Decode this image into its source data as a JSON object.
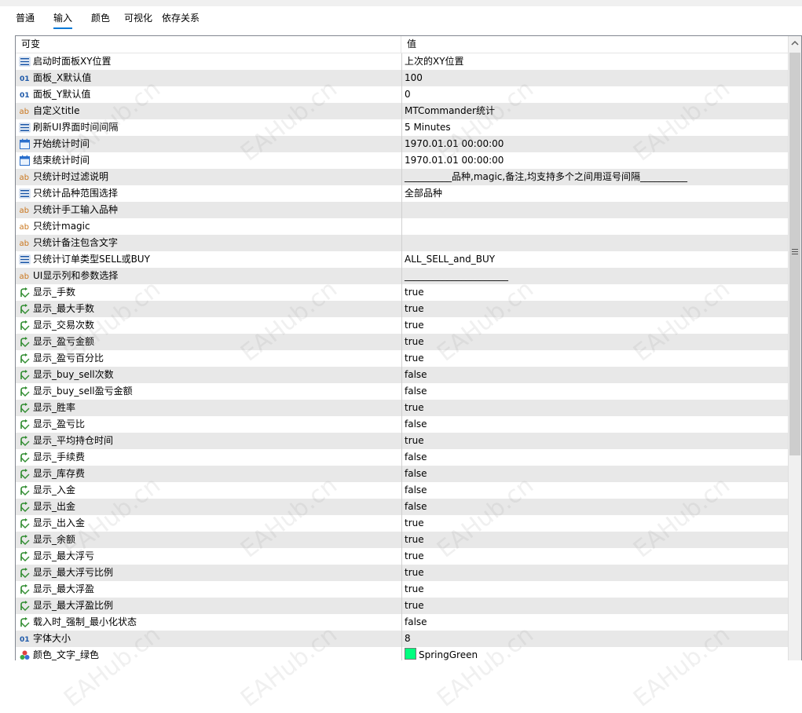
{
  "tabs": [
    {
      "label": "普通",
      "active": false
    },
    {
      "label": "输入",
      "active": true
    },
    {
      "label": "颜色",
      "active": false
    },
    {
      "label": "可视化",
      "active": false
    },
    {
      "label": "依存关系",
      "active": false
    }
  ],
  "header": {
    "variable": "可变",
    "value": "值"
  },
  "rows": [
    {
      "icon": "enum-icon",
      "name": "启动时面板XY位置",
      "value": "上次的XY位置"
    },
    {
      "icon": "int-icon",
      "name": "面板_X默认值",
      "value": "100"
    },
    {
      "icon": "int-icon",
      "name": "面板_Y默认值",
      "value": "0"
    },
    {
      "icon": "text-icon",
      "name": "自定义title",
      "value": "MTCommander统计"
    },
    {
      "icon": "enum-icon",
      "name": "刷新UI界面时间间隔",
      "value": "5 Minutes"
    },
    {
      "icon": "calendar-icon",
      "name": "开始统计时间",
      "value": "1970.01.01 00:00:00"
    },
    {
      "icon": "calendar-icon",
      "name": "结束统计时间",
      "value": "1970.01.01 00:00:00"
    },
    {
      "icon": "text-icon",
      "name": "只统计时过滤说明",
      "value": "__________品种,magic,备注,均支持多个之间用逗号间隔__________"
    },
    {
      "icon": "enum-icon",
      "name": "只统计品种范围选择",
      "value": "全部品种"
    },
    {
      "icon": "text-icon",
      "name": "只统计手工输入品种",
      "value": ""
    },
    {
      "icon": "text-icon",
      "name": "只统计magic",
      "value": ""
    },
    {
      "icon": "text-icon",
      "name": "只统计备注包含文字",
      "value": ""
    },
    {
      "icon": "enum-icon",
      "name": "只统计订单类型SELL或BUY",
      "value": "ALL_SELL_and_BUY"
    },
    {
      "icon": "text-icon",
      "name": "UI显示列和参数选择",
      "value": "______________________"
    },
    {
      "icon": "bool-icon",
      "name": "显示_手数",
      "value": "true"
    },
    {
      "icon": "bool-icon",
      "name": "显示_最大手数",
      "value": "true"
    },
    {
      "icon": "bool-icon",
      "name": "显示_交易次数",
      "value": "true"
    },
    {
      "icon": "bool-icon",
      "name": "显示_盈亏金额",
      "value": "true"
    },
    {
      "icon": "bool-icon",
      "name": "显示_盈亏百分比",
      "value": "true"
    },
    {
      "icon": "bool-icon",
      "name": "显示_buy_sell次数",
      "value": "false"
    },
    {
      "icon": "bool-icon",
      "name": "显示_buy_sell盈亏金额",
      "value": "false"
    },
    {
      "icon": "bool-icon",
      "name": "显示_胜率",
      "value": "true"
    },
    {
      "icon": "bool-icon",
      "name": "显示_盈亏比",
      "value": "false"
    },
    {
      "icon": "bool-icon",
      "name": "显示_平均持仓时间",
      "value": "true"
    },
    {
      "icon": "bool-icon",
      "name": "显示_手续费",
      "value": "false"
    },
    {
      "icon": "bool-icon",
      "name": "显示_库存费",
      "value": "false"
    },
    {
      "icon": "bool-icon",
      "name": "显示_入金",
      "value": "false"
    },
    {
      "icon": "bool-icon",
      "name": "显示_出金",
      "value": "false"
    },
    {
      "icon": "bool-icon",
      "name": "显示_出入金",
      "value": "true"
    },
    {
      "icon": "bool-icon",
      "name": "显示_余额",
      "value": "true"
    },
    {
      "icon": "bool-icon",
      "name": "显示_最大浮亏",
      "value": "true"
    },
    {
      "icon": "bool-icon",
      "name": "显示_最大浮亏比例",
      "value": "true"
    },
    {
      "icon": "bool-icon",
      "name": "显示_最大浮盈",
      "value": "true"
    },
    {
      "icon": "bool-icon",
      "name": "显示_最大浮盈比例",
      "value": "true"
    },
    {
      "icon": "bool-icon",
      "name": "载入时_强制_最小化状态",
      "value": "false"
    },
    {
      "icon": "int-icon",
      "name": "字体大小",
      "value": "8"
    },
    {
      "icon": "color-icon",
      "name": "颜色_文字_绿色",
      "value": "SpringGreen",
      "swatch": "#00ff7f"
    }
  ],
  "watermark": "EAHub.cn",
  "colors": {
    "accent": "#0078d7",
    "row_alt": "#e8e8e8",
    "text_icon": "#c9751b",
    "int_icon": "#1b57a8",
    "bool_icon": "#2e8b2e"
  }
}
